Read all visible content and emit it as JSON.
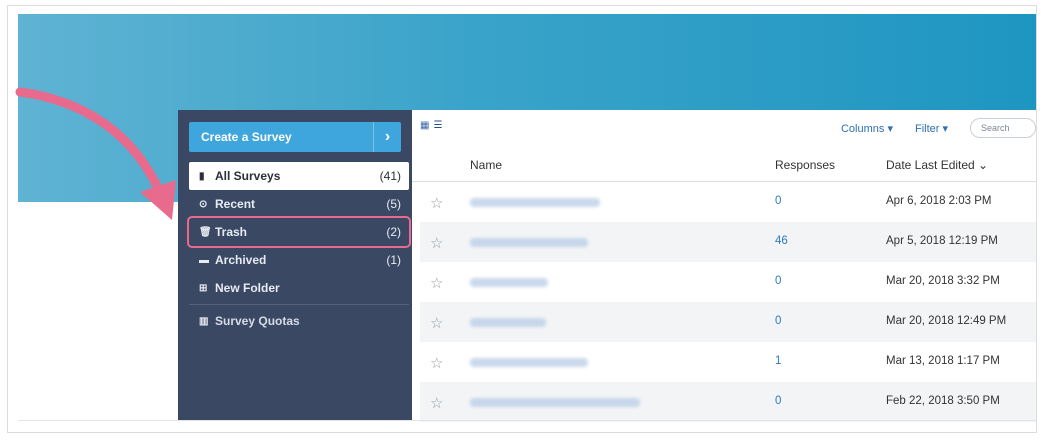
{
  "sidebar": {
    "create_label": "Create a Survey",
    "create_arrow": "›",
    "items": [
      {
        "icon": "file-icon",
        "glyph": "▮",
        "label": "All Surveys",
        "count": "(41)"
      },
      {
        "icon": "clock-icon",
        "glyph": "⊙",
        "label": "Recent",
        "count": "(5)"
      },
      {
        "icon": "trash-icon",
        "glyph": "🗑",
        "label": "Trash",
        "count": "(2)"
      },
      {
        "icon": "archive-icon",
        "glyph": "▬",
        "label": "Archived",
        "count": "(1)"
      },
      {
        "icon": "new-folder-icon",
        "glyph": "⊞",
        "label": "New Folder",
        "count": ""
      },
      {
        "icon": "bar-chart-icon",
        "glyph": "▥",
        "label": "Survey Quotas",
        "count": ""
      }
    ]
  },
  "toolbar": {
    "columns_label": "Columns ▾",
    "filter_label": "Filter ▾",
    "search_placeholder": "Search"
  },
  "table": {
    "headers": {
      "name": "Name",
      "responses": "Responses",
      "date": "Date Last Edited ⌄"
    },
    "rows": [
      {
        "responses": "0",
        "date": "Apr 6, 2018 2:03 PM"
      },
      {
        "responses": "46",
        "date": "Apr 5, 2018 12:19 PM"
      },
      {
        "responses": "0",
        "date": "Mar 20, 2018 3:32 PM"
      },
      {
        "responses": "0",
        "date": "Mar 20, 2018 12:49 PM"
      },
      {
        "responses": "1",
        "date": "Mar 13, 2018 1:17 PM"
      },
      {
        "responses": "0",
        "date": "Feb 22, 2018 3:50 PM"
      }
    ]
  },
  "colors": {
    "accent": "#3ea6dd",
    "sidebar": "#3b4863",
    "highlight": "#e86a8d",
    "banner": "#2a9ec8"
  }
}
